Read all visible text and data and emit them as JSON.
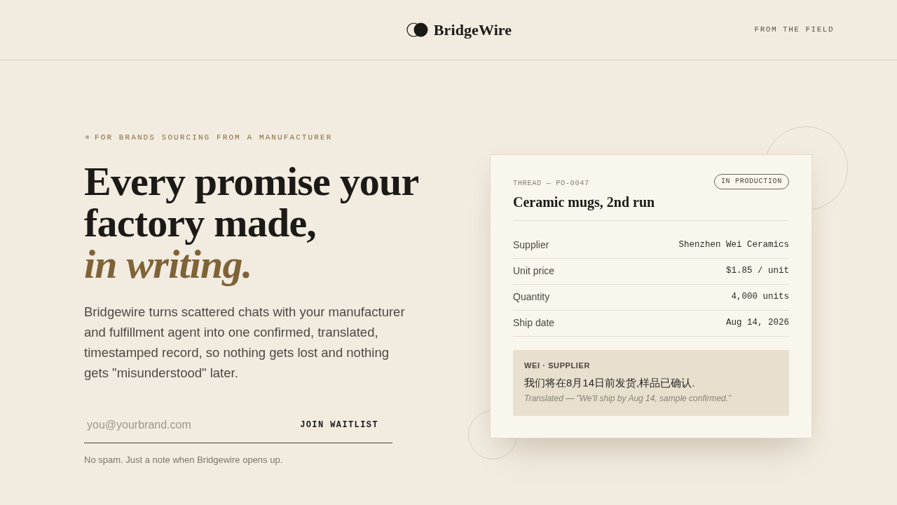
{
  "header": {
    "brand": "BridgeWire",
    "nav_link": "FROM THE FIELD"
  },
  "hero": {
    "eyebrow": "FOR BRANDS SOURCING FROM A MANUFACTURER",
    "headline": "Every promise your factory made, *in writing.*",
    "description": "Bridgewire turns scattered chats with your manufacturer and fulfillment agent into one confirmed, translated, timestamped record, so nothing gets lost and nothing gets \"misunderstood\" later.",
    "signup": {
      "placeholder": "you@yourbrand.com",
      "button": "JOIN WAITLIST"
    },
    "note": "No spam. Just a note when Bridgewire opens up."
  },
  "thread_card": {
    "thread_id": "THREAD — PO-0047",
    "title": "Ceramic mugs, 2nd run",
    "status": "IN PRODUCTION",
    "fields": [
      {
        "label": "Supplier",
        "value": "Shenzhen Wei Ceramics"
      },
      {
        "label": "Unit price",
        "value": "$1.85 / unit"
      },
      {
        "label": "Quantity",
        "value": "4,000 units"
      },
      {
        "label": "Ship date",
        "value": "Aug 14, 2026"
      }
    ],
    "message": {
      "sender": "WEI · SUPPLIER",
      "original": "我们将在8月14日前发货,样品已确认.",
      "translation": "Translated — \"We'll ship by Aug 14, sample confirmed.\""
    }
  }
}
